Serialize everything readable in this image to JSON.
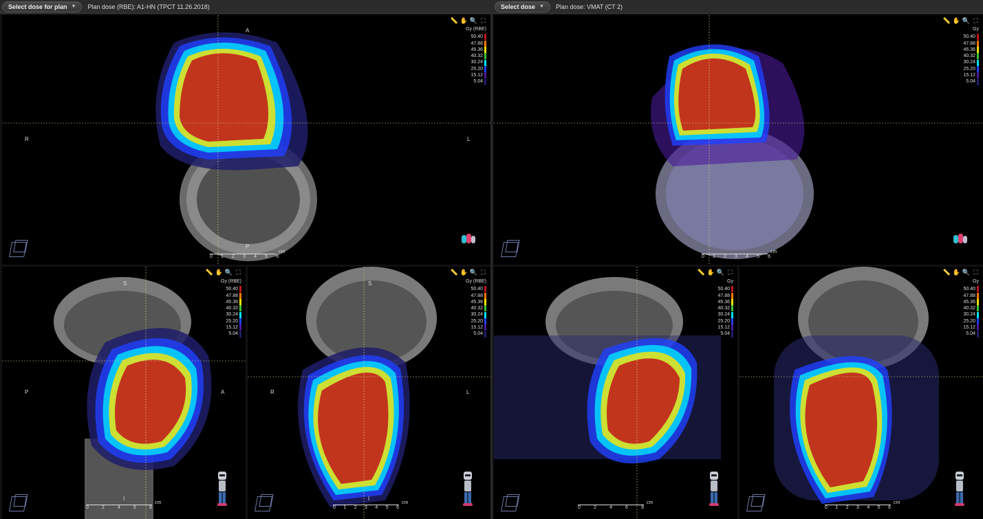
{
  "left_panel": {
    "select_label": "Select dose for plan",
    "plan_label": "Plan dose (RBE): A1-HN (TPCT 11.26.2018)",
    "unit": "Gy (RBE)"
  },
  "right_panel": {
    "select_label": "Select dose",
    "plan_label": "Plan dose: VMAT (CT 2)",
    "unit": "Gy"
  },
  "legend": {
    "levels": [
      "50.40",
      "47.88",
      "45.36",
      "40.32",
      "30.24",
      "25.20",
      "15.12",
      "5.04"
    ],
    "colors": [
      "#c0171a",
      "#ff7a00",
      "#ffe600",
      "#3cc43c",
      "#00e6ff",
      "#2040ff",
      "#4a1a9a",
      "#1e1e6a"
    ]
  },
  "orientation": {
    "axial": {
      "left": "R",
      "right": "L",
      "top": "A",
      "bottom": "P"
    },
    "sagittal": {
      "top": "S",
      "left": "P",
      "right": "A",
      "bottom": "I"
    },
    "coronal": {
      "top": "S",
      "left": "R",
      "right": "L",
      "bottom": "I"
    }
  },
  "scale": {
    "axial_ticks": [
      "0",
      "1",
      "2",
      "3",
      "4",
      "5",
      "6"
    ],
    "small_ticks": [
      "0",
      "2",
      "4",
      "6",
      "8"
    ],
    "unit": "cm"
  },
  "icons": [
    "ruler-icon",
    "pan-hand-icon",
    "zoom-icon",
    "fullscreen-icon"
  ]
}
